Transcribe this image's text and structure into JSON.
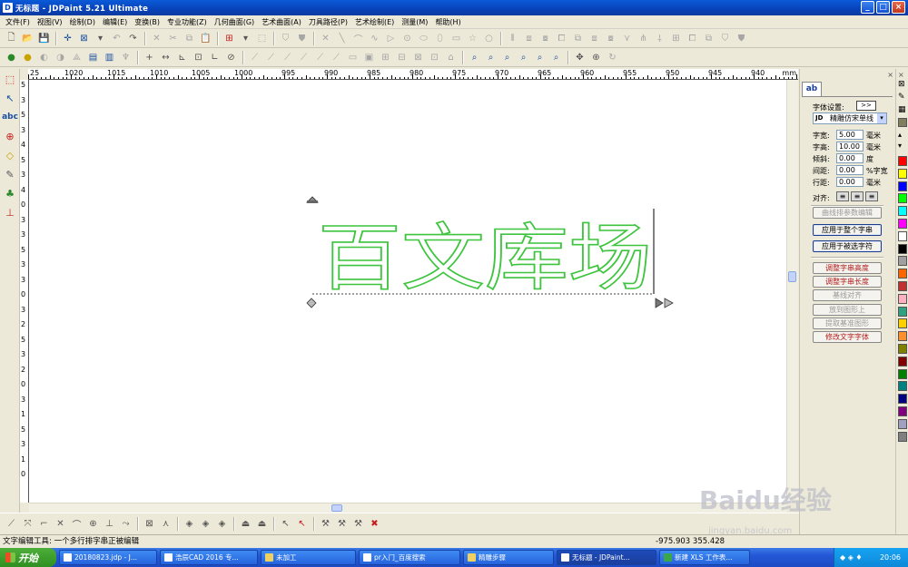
{
  "window": {
    "title": "无标题 - JDPaint 5.21 Ultimate",
    "app_icon": "JD-logo",
    "buttons": {
      "minimize": "_",
      "maximize": "□",
      "close": "×"
    }
  },
  "menu": [
    "文件(F)",
    "视图(V)",
    "绘制(D)",
    "编辑(E)",
    "变换(B)",
    "专业功能(Z)",
    "几何曲面(G)",
    "艺术曲面(A)",
    "刀具路径(P)",
    "艺术绘制(E)",
    "测量(M)",
    "帮助(H)"
  ],
  "ruler": {
    "top_labels": [
      "25",
      "1020",
      "1015",
      "1010",
      "1005",
      "1000",
      "995",
      "990",
      "985",
      "980",
      "975",
      "970",
      "965",
      "960",
      "955",
      "950",
      "945",
      "940"
    ],
    "unit": "mm",
    "left_digits": [
      "5",
      "3",
      "5",
      "3",
      "4",
      "5",
      "3",
      "4",
      "0",
      "3",
      "3",
      "5",
      "3",
      "3",
      "0",
      "3",
      "2",
      "5",
      "3",
      "2",
      "0",
      "3",
      "1",
      "5",
      "3",
      "1",
      "0"
    ]
  },
  "canvas": {
    "text_object": "百文库场",
    "text_color": "#3ec43e"
  },
  "right_panel": {
    "tab_label": "ab",
    "font_settings_label": "字体设置:",
    "font_settings_btn": ">>",
    "font_name": "精雕仿宋单线",
    "font_badge": "JD",
    "fields": [
      {
        "label": "字宽:",
        "value": "5.00",
        "unit": "毫米"
      },
      {
        "label": "字高:",
        "value": "10.00",
        "unit": "毫米"
      },
      {
        "label": "倾斜:",
        "value": "0.00",
        "unit": "度"
      },
      {
        "label": "间距:",
        "value": "0.00",
        "unit": "%字宽"
      },
      {
        "label": "行距:",
        "value": "0.00",
        "unit": "毫米"
      }
    ],
    "align_label": "对齐:",
    "buttons": [
      {
        "label": "曲线排参数编辑",
        "state": "disabled"
      },
      {
        "label": "应用于整个字串",
        "state": "bold"
      },
      {
        "label": "应用于被选字符",
        "state": "bold"
      },
      {
        "label": "调整字串高度",
        "state": "red"
      },
      {
        "label": "调整字串长度",
        "state": "red"
      },
      {
        "label": "基线对齐",
        "state": "disabled"
      },
      {
        "label": "放到图形上",
        "state": "disabled"
      },
      {
        "label": "提取基准图形",
        "state": "disabled"
      },
      {
        "label": "修改文字字体",
        "state": "red"
      }
    ]
  },
  "palette": [
    "#ff0000",
    "#ffff00",
    "#0000ff",
    "#00ff00",
    "#00ffff",
    "#ff00ff",
    "#ffffff",
    "#000000",
    "#a0a0a0",
    "#ff6600",
    "#c03030",
    "#ffb0c0",
    "#30a080",
    "#ffd000",
    "#ff9030",
    "#808000",
    "#800000",
    "#008000",
    "#008080",
    "#000080",
    "#800080",
    "#a0a0c0",
    "#808080"
  ],
  "status": {
    "text": "文字编辑工具: 一个多行排字串正被编辑",
    "coords": "-975.903   355.428"
  },
  "taskbar": {
    "start": "开始",
    "tasks": [
      {
        "label": "20180823.jdp - J...",
        "active": false
      },
      {
        "label": "浩辰CAD 2016 专...",
        "active": false
      },
      {
        "label": "未加工",
        "active": false
      },
      {
        "label": "pr入门_百度搜索",
        "active": false
      },
      {
        "label": "精雕步骤",
        "active": false
      },
      {
        "label": "无标题 - JDPaint...",
        "active": true
      },
      {
        "label": "新建 XLS 工作表...",
        "active": false
      }
    ],
    "clock": "20:06"
  },
  "watermark": {
    "big": "Baidu经验",
    "small": "jingyan.baidu.com"
  }
}
